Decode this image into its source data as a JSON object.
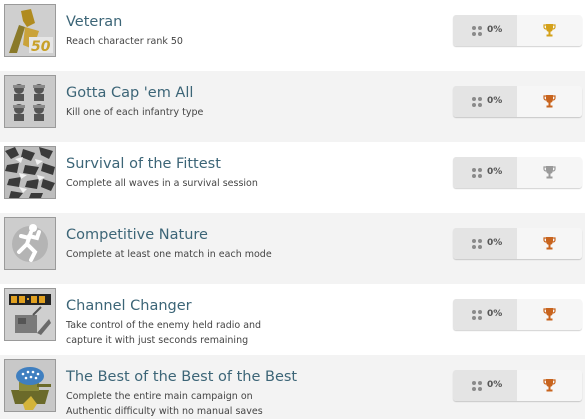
{
  "achievements": [
    {
      "title": "Veteran",
      "desc": "Reach character rank 50",
      "percent": "0%",
      "trophy_color": "#d4a11a",
      "thumb_icon": "veteran-rank-50-icon"
    },
    {
      "title": "Gotta Cap 'em All",
      "desc": "Kill one of each infantry type",
      "percent": "0%",
      "trophy_color": "#c8641e",
      "thumb_icon": "infantry-soldiers-icon"
    },
    {
      "title": "Survival of the Fittest",
      "desc": "Complete all waves in a survival session",
      "percent": "0%",
      "trophy_color": "#9a9a9a",
      "thumb_icon": "camouflage-icon"
    },
    {
      "title": "Competitive Nature",
      "desc": "Complete at least one match in each mode",
      "percent": "0%",
      "trophy_color": "#c8641e",
      "thumb_icon": "running-soldier-icon"
    },
    {
      "title": "Channel Changer",
      "desc": "Take control of the enemy held radio and capture it with just seconds remaining",
      "percent": "0%",
      "trophy_color": "#c8641e",
      "thumb_icon": "radio-timer-icon"
    },
    {
      "title": "The Best of the Best of the Best",
      "desc": "Complete the entire main campaign on Authentic difficulty with no manual saves",
      "percent": "0%",
      "trophy_color": "#c8641e",
      "thumb_icon": "tank-medal-icon"
    }
  ]
}
